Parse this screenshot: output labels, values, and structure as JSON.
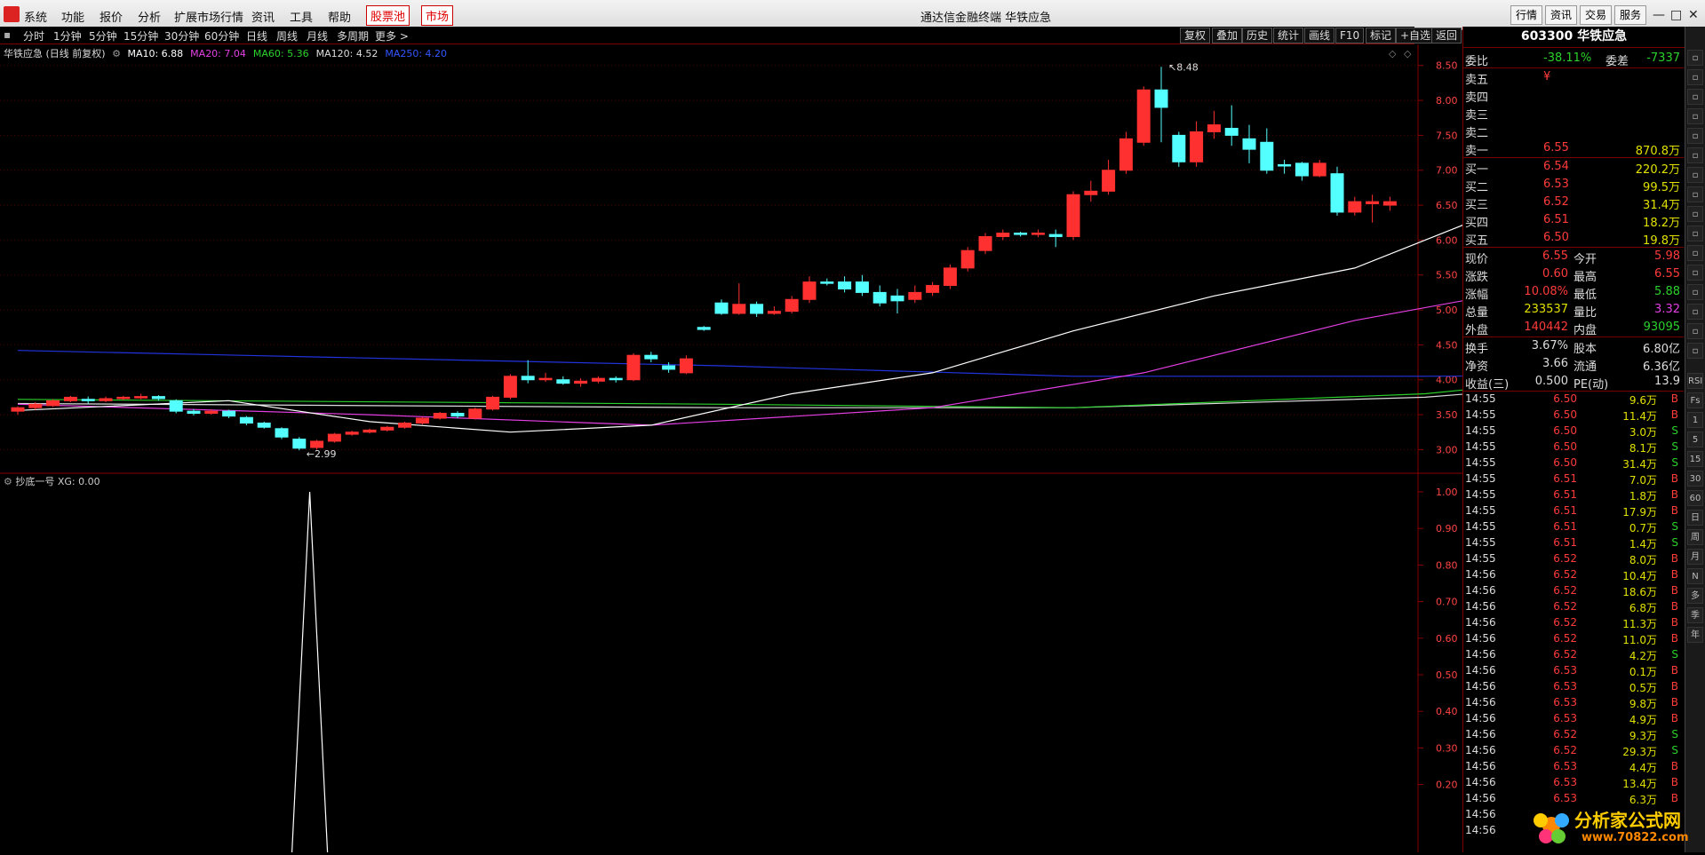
{
  "menubar": {
    "items": [
      "系统",
      "功能",
      "报价",
      "分析",
      "扩展市场行情",
      "资讯",
      "工具",
      "帮助"
    ],
    "hot1": "股票池",
    "hot2": "市场",
    "title": "通达信金融终端  华铁应急",
    "right_buttons": [
      "行情",
      "资讯",
      "交易",
      "服务"
    ],
    "win_controls": [
      "—",
      "□",
      "✕"
    ]
  },
  "toolbar": {
    "periods": [
      "分时",
      "1分钟",
      "5分钟",
      "15分钟",
      "30分钟",
      "60分钟",
      "日线",
      "周线",
      "月线",
      "多周期",
      "更多 >"
    ],
    "right": [
      "复权",
      "叠加",
      "历史",
      "统计",
      "画线",
      "F10",
      "标记",
      "+自选",
      "返回"
    ]
  },
  "chart_header": {
    "name": "华铁应急 (日线 前复权)",
    "ma": [
      {
        "label": "MA10: 6.88",
        "color": "#ffffff"
      },
      {
        "label": "MA20: 7.04",
        "color": "#e33fe3"
      },
      {
        "label": "MA60: 5.36",
        "color": "#2bd12b"
      },
      {
        "label": "MA120: 4.52",
        "color": "#dddddd"
      },
      {
        "label": "MA250: 4.20",
        "color": "#3355ff"
      }
    ]
  },
  "indicator_header": "抄底一号  XG: 0.00",
  "chart_data": {
    "type": "candlestick",
    "ylim": [
      2.7,
      8.7
    ],
    "price_ticks": [
      "8.50",
      "8.00",
      "7.50",
      "7.00",
      "6.50",
      "6.00",
      "5.50",
      "5.00",
      "4.50",
      "4.00",
      "3.50",
      "3.00"
    ],
    "high_label": "8.48",
    "low_label": "2.99",
    "candles": [
      [
        3.55,
        3.6,
        3.5,
        3.62
      ],
      [
        3.6,
        3.65,
        3.57,
        3.68
      ],
      [
        3.63,
        3.7,
        3.61,
        3.72
      ],
      [
        3.7,
        3.75,
        3.68,
        3.77
      ],
      [
        3.72,
        3.7,
        3.66,
        3.76
      ],
      [
        3.7,
        3.73,
        3.68,
        3.76
      ],
      [
        3.73,
        3.75,
        3.71,
        3.77
      ],
      [
        3.74,
        3.76,
        3.72,
        3.8
      ],
      [
        3.76,
        3.73,
        3.7,
        3.78
      ],
      [
        3.7,
        3.55,
        3.52,
        3.72
      ],
      [
        3.55,
        3.52,
        3.49,
        3.58
      ],
      [
        3.52,
        3.55,
        3.5,
        3.58
      ],
      [
        3.55,
        3.48,
        3.45,
        3.57
      ],
      [
        3.46,
        3.38,
        3.35,
        3.48
      ],
      [
        3.38,
        3.32,
        3.3,
        3.4
      ],
      [
        3.3,
        3.18,
        3.15,
        3.32
      ],
      [
        3.15,
        3.02,
        2.99,
        3.18
      ],
      [
        3.03,
        3.12,
        3.0,
        3.14
      ],
      [
        3.12,
        3.22,
        3.1,
        3.24
      ],
      [
        3.22,
        3.25,
        3.2,
        3.27
      ],
      [
        3.25,
        3.28,
        3.23,
        3.3
      ],
      [
        3.28,
        3.32,
        3.26,
        3.34
      ],
      [
        3.32,
        3.38,
        3.3,
        3.4
      ],
      [
        3.38,
        3.45,
        3.36,
        3.47
      ],
      [
        3.45,
        3.52,
        3.43,
        3.54
      ],
      [
        3.52,
        3.48,
        3.45,
        3.55
      ],
      [
        3.45,
        3.58,
        3.43,
        3.6
      ],
      [
        3.58,
        3.75,
        3.56,
        3.77
      ],
      [
        3.75,
        4.05,
        3.72,
        4.08
      ],
      [
        4.05,
        4.0,
        3.95,
        4.28
      ],
      [
        4.0,
        4.02,
        3.97,
        4.1
      ],
      [
        4.0,
        3.95,
        3.93,
        4.05
      ],
      [
        3.95,
        3.98,
        3.9,
        4.02
      ],
      [
        3.98,
        4.02,
        3.95,
        4.05
      ],
      [
        4.02,
        4.0,
        3.96,
        4.05
      ],
      [
        4.0,
        4.35,
        3.98,
        4.38
      ],
      [
        4.35,
        4.3,
        4.25,
        4.4
      ],
      [
        4.2,
        4.15,
        4.1,
        4.25
      ],
      [
        4.1,
        4.3,
        4.08,
        4.35
      ],
      [
        4.75,
        4.72,
        4.7,
        4.77
      ],
      [
        5.1,
        4.95,
        4.93,
        5.15
      ],
      [
        4.95,
        5.08,
        4.93,
        5.38
      ],
      [
        5.08,
        4.95,
        4.9,
        5.12
      ],
      [
        4.95,
        4.98,
        4.93,
        5.05
      ],
      [
        4.98,
        5.15,
        4.95,
        5.2
      ],
      [
        5.15,
        5.4,
        5.1,
        5.48
      ],
      [
        5.4,
        5.38,
        5.35,
        5.45
      ],
      [
        5.4,
        5.3,
        5.25,
        5.48
      ],
      [
        5.4,
        5.25,
        5.2,
        5.5
      ],
      [
        5.25,
        5.1,
        5.05,
        5.35
      ],
      [
        5.2,
        5.13,
        4.95,
        5.3
      ],
      [
        5.15,
        5.25,
        5.1,
        5.35
      ],
      [
        5.25,
        5.35,
        5.2,
        5.4
      ],
      [
        5.35,
        5.6,
        5.3,
        5.65
      ],
      [
        5.6,
        5.85,
        5.55,
        5.9
      ],
      [
        5.85,
        6.05,
        5.8,
        6.1
      ],
      [
        6.05,
        6.1,
        6.0,
        6.15
      ],
      [
        6.1,
        6.08,
        6.05,
        6.12
      ],
      [
        6.08,
        6.1,
        6.04,
        6.15
      ],
      [
        6.08,
        6.05,
        5.9,
        6.15
      ],
      [
        6.05,
        6.65,
        6.0,
        6.7
      ],
      [
        6.65,
        6.7,
        6.55,
        6.85
      ],
      [
        6.7,
        7.0,
        6.65,
        7.15
      ],
      [
        7.0,
        7.45,
        6.95,
        7.55
      ],
      [
        7.4,
        8.15,
        7.35,
        8.2
      ],
      [
        8.15,
        7.9,
        7.4,
        8.48
      ],
      [
        7.5,
        7.12,
        7.05,
        7.55
      ],
      [
        7.12,
        7.55,
        7.05,
        7.7
      ],
      [
        7.55,
        7.65,
        7.45,
        7.85
      ],
      [
        7.6,
        7.5,
        7.35,
        7.93
      ],
      [
        7.45,
        7.3,
        7.1,
        7.65
      ],
      [
        7.4,
        7.0,
        6.95,
        7.6
      ],
      [
        7.08,
        7.06,
        6.95,
        7.15
      ],
      [
        7.1,
        6.92,
        6.85,
        7.12
      ],
      [
        6.92,
        7.1,
        6.9,
        7.15
      ],
      [
        6.95,
        6.4,
        6.35,
        7.05
      ],
      [
        6.4,
        6.55,
        6.35,
        6.62
      ],
      [
        6.52,
        6.55,
        6.25,
        6.65
      ],
      [
        6.5,
        6.55,
        6.42,
        6.62
      ]
    ],
    "ma10": [
      [
        0,
        3.56
      ],
      [
        12,
        3.7
      ],
      [
        20,
        3.4
      ],
      [
        28,
        3.25
      ],
      [
        36,
        3.35
      ],
      [
        44,
        3.8
      ],
      [
        52,
        4.1
      ],
      [
        60,
        4.7
      ],
      [
        68,
        5.2
      ],
      [
        76,
        5.6
      ],
      [
        84,
        6.4
      ],
      [
        88,
        7.0
      ],
      [
        92,
        7.4
      ],
      [
        100,
        7.5
      ],
      [
        108,
        7.2
      ],
      [
        116,
        6.88
      ]
    ],
    "ma20": [
      [
        0,
        3.65
      ],
      [
        20,
        3.5
      ],
      [
        36,
        3.35
      ],
      [
        52,
        3.6
      ],
      [
        64,
        4.1
      ],
      [
        76,
        4.85
      ],
      [
        88,
        5.4
      ],
      [
        100,
        6.2
      ],
      [
        108,
        6.8
      ],
      [
        116,
        7.04
      ]
    ],
    "ma60": [
      [
        0,
        3.72
      ],
      [
        40,
        3.65
      ],
      [
        60,
        3.6
      ],
      [
        80,
        3.8
      ],
      [
        100,
        4.3
      ],
      [
        116,
        5.36
      ]
    ],
    "ma120": [
      [
        0,
        3.66
      ],
      [
        40,
        3.6
      ],
      [
        60,
        3.6
      ],
      [
        80,
        3.75
      ],
      [
        100,
        4.15
      ],
      [
        116,
        4.52
      ]
    ],
    "ma250": [
      [
        0,
        4.42
      ],
      [
        40,
        4.2
      ],
      [
        60,
        4.05
      ],
      [
        80,
        4.05
      ],
      [
        100,
        4.08
      ],
      [
        116,
        4.2
      ]
    ],
    "indicator_ticks": [
      "1.00",
      "0.90",
      "0.80",
      "0.70",
      "0.60",
      "0.50",
      "0.40",
      "0.30",
      "0.20"
    ],
    "indicator_ylim": [
      0,
      1.0
    ],
    "indicator_spike_index": 17
  },
  "quote": {
    "code_name": "603300 华铁应急",
    "weibi_label": "委比",
    "weibi": "-38.11%",
    "weicha_label": "委差",
    "weicha": "-7337",
    "asks": [
      {
        "label": "卖五",
        "price": "¥",
        "vol": ""
      },
      {
        "label": "卖四",
        "price": "",
        "vol": ""
      },
      {
        "label": "卖三",
        "price": "",
        "vol": ""
      },
      {
        "label": "卖二",
        "price": "",
        "vol": ""
      },
      {
        "label": "卖一",
        "price": "6.55",
        "vol": "870.8万"
      }
    ],
    "bids": [
      {
        "label": "买一",
        "price": "6.54",
        "vol": "220.2万"
      },
      {
        "label": "买二",
        "price": "6.53",
        "vol": "99.5万"
      },
      {
        "label": "买三",
        "price": "6.52",
        "vol": "31.4万"
      },
      {
        "label": "买四",
        "price": "6.51",
        "vol": "18.2万"
      },
      {
        "label": "买五",
        "price": "6.50",
        "vol": "19.8万"
      }
    ],
    "stats": [
      {
        "l1": "现价",
        "v1": "6.55",
        "c1": "r",
        "l2": "今开",
        "v2": "5.98",
        "c2": "r"
      },
      {
        "l1": "涨跌",
        "v1": "0.60",
        "c1": "r",
        "l2": "最高",
        "v2": "6.55",
        "c2": "r"
      },
      {
        "l1": "涨幅",
        "v1": "10.08%",
        "c1": "r",
        "l2": "最低",
        "v2": "5.88",
        "c2": "g"
      },
      {
        "l1": "总量",
        "v1": "233537",
        "c1": "y",
        "l2": "量比",
        "v2": "3.32",
        "c2": "m"
      },
      {
        "l1": "外盘",
        "v1": "140442",
        "c1": "r",
        "l2": "内盘",
        "v2": "93095",
        "c2": "g"
      }
    ],
    "stats2": [
      {
        "l1": "换手",
        "v1": "3.67%",
        "l2": "股本",
        "v2": "6.80亿"
      },
      {
        "l1": "净资",
        "v1": "3.66",
        "l2": "流通",
        "v2": "6.36亿"
      },
      {
        "l1": "收益(三)",
        "v1": "0.500",
        "l2": "PE(动)",
        "v2": "13.9"
      }
    ],
    "ticks": [
      [
        "14:55",
        "6.50",
        "9.6万",
        "B"
      ],
      [
        "14:55",
        "6.50",
        "11.4万",
        "B"
      ],
      [
        "14:55",
        "6.50",
        "3.0万",
        "S"
      ],
      [
        "14:55",
        "6.50",
        "8.1万",
        "S"
      ],
      [
        "14:55",
        "6.50",
        "31.4万",
        "S"
      ],
      [
        "14:55",
        "6.51",
        "7.0万",
        "B"
      ],
      [
        "14:55",
        "6.51",
        "1.8万",
        "B"
      ],
      [
        "14:55",
        "6.51",
        "17.9万",
        "B"
      ],
      [
        "14:55",
        "6.51",
        "0.7万",
        "S"
      ],
      [
        "14:55",
        "6.51",
        "1.4万",
        "S"
      ],
      [
        "14:55",
        "6.52",
        "8.0万",
        "B"
      ],
      [
        "14:56",
        "6.52",
        "10.4万",
        "B"
      ],
      [
        "14:56",
        "6.52",
        "18.6万",
        "B"
      ],
      [
        "14:56",
        "6.52",
        "6.8万",
        "B"
      ],
      [
        "14:56",
        "6.52",
        "11.3万",
        "B"
      ],
      [
        "14:56",
        "6.52",
        "11.0万",
        "B"
      ],
      [
        "14:56",
        "6.52",
        "4.2万",
        "S"
      ],
      [
        "14:56",
        "6.53",
        "0.1万",
        "B"
      ],
      [
        "14:56",
        "6.53",
        "0.5万",
        "B"
      ],
      [
        "14:56",
        "6.53",
        "9.8万",
        "B"
      ],
      [
        "14:56",
        "6.53",
        "4.9万",
        "B"
      ],
      [
        "14:56",
        "6.52",
        "9.3万",
        "S"
      ],
      [
        "14:56",
        "6.52",
        "29.3万",
        "S"
      ],
      [
        "14:56",
        "6.53",
        "4.4万",
        "B"
      ],
      [
        "14:56",
        "6.53",
        "13.4万",
        "B"
      ],
      [
        "14:56",
        "6.53",
        "6.3万",
        "B"
      ],
      [
        "14:56",
        "",
        "",
        ""
      ],
      [
        "14:56",
        "",
        "",
        ""
      ]
    ]
  },
  "sidebar": [
    "RSI",
    "Fs",
    "1",
    "5",
    "15",
    "30",
    "60",
    "日",
    "周",
    "月",
    "N",
    "多",
    "季",
    "年"
  ],
  "watermark": {
    "line1": "分析家公式网",
    "line2": "www.70822.com"
  }
}
